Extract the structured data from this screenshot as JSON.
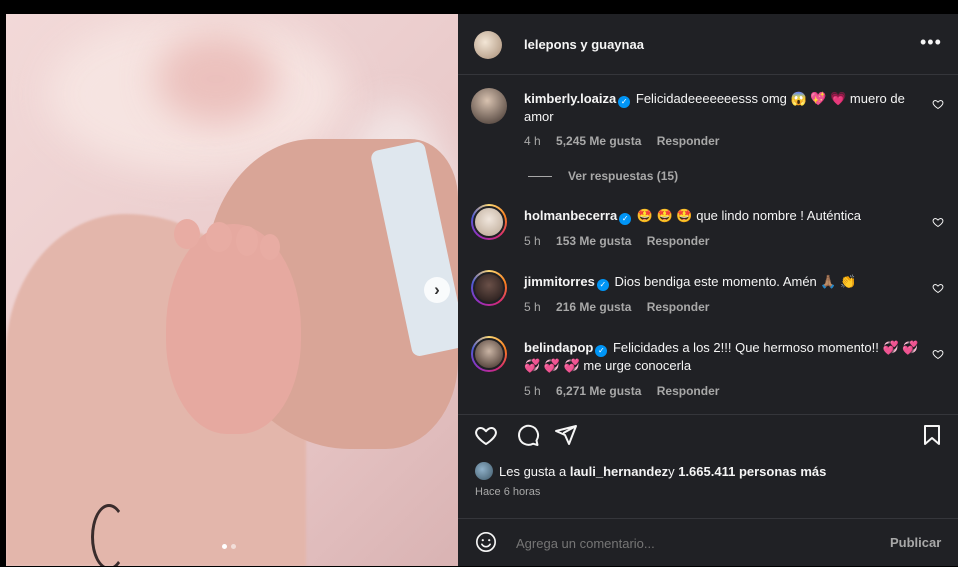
{
  "header": {
    "title": "lelepons y guaynaa",
    "more_label": "•••"
  },
  "comments": [
    {
      "user": "kimberly.loaiza",
      "text": "Felicidadeeeeeeesss omg 😱 💖 💗  muero de amor",
      "time": "4 h",
      "likes": "5,245 Me gusta",
      "reply": "Responder"
    },
    {
      "user": "holmanbecerra",
      "text": "🤩 🤩 🤩 que lindo nombre ! Auténtica",
      "time": "5 h",
      "likes": "153 Me gusta",
      "reply": "Responder"
    },
    {
      "user": "jimmitorres",
      "text": "Dios bendiga este momento. Amén 🙏🏽 👏",
      "time": "5 h",
      "likes": "216 Me gusta",
      "reply": "Responder"
    },
    {
      "user": "belindapop",
      "text": "Felicidades a los 2!!! Que hermoso momento!! 💞 💞 💞 💞 💞 me urge conocerla",
      "time": "5 h",
      "likes": "6,271 Me gusta",
      "reply": "Responder"
    }
  ],
  "view_replies": "Ver respuestas (15)",
  "likes_line": {
    "prefix": "Les gusta a ",
    "user": "lauli_hernandez",
    "middle": " y ",
    "count": "1.665.411 personas más"
  },
  "posted_ago": "Hace 6 horas",
  "composer": {
    "placeholder": "Agrega un comentario...",
    "publish": "Publicar"
  },
  "carousel": {
    "current": 1,
    "total": 2,
    "next_icon": "›"
  },
  "colors": {
    "panel_bg": "#202125",
    "accent": "#0095f6",
    "muted": "#a8a8a8"
  }
}
